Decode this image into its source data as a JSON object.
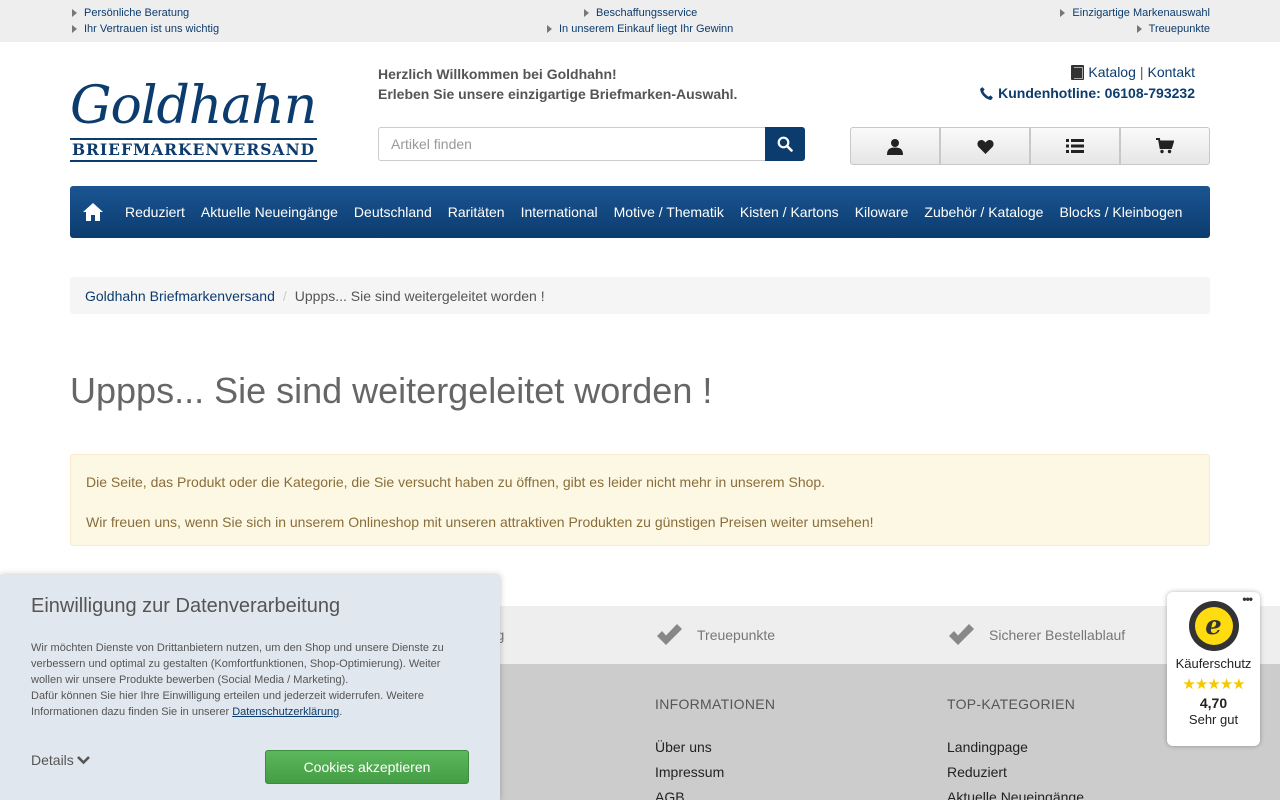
{
  "topbar": {
    "left1": "Persönliche Beratung",
    "left2": "Ihr Vertrauen ist uns wichtig",
    "center1": "Beschaffungsservice",
    "center2": "In unserem Einkauf liegt Ihr Gewinn",
    "right1": "Einzigartige Markenauswahl",
    "right2": "Treuepunkte"
  },
  "logo": {
    "line1": "Goldhahn",
    "line2": "BRIEFMARKENVERSAND"
  },
  "welcome": {
    "line1": "Herzlich Willkommen bei Goldhahn!",
    "line2": "Erleben Sie unsere einzigartige Briefmarken-Auswahl."
  },
  "headlinks": {
    "katalog": "Katalog",
    "separator": "|",
    "kontakt": "Kontakt",
    "hotline": "Kundenhotline: 06108-793232"
  },
  "search": {
    "placeholder": "Artikel finden"
  },
  "nav": {
    "items": [
      "Reduziert",
      "Aktuelle Neueingänge",
      "Deutschland",
      "Raritäten",
      "International",
      "Motive / Thematik",
      "Kisten / Kartons",
      "Kiloware",
      "Zubehör / Kataloge",
      "Blocks / Kleinbogen"
    ]
  },
  "breadcrumb": {
    "home": "Goldhahn Briefmarkenversand",
    "separator": "/",
    "current": "Uppps... Sie sind weitergeleitet worden !"
  },
  "page": {
    "title": "Uppps... Sie sind weitergeleitet worden !"
  },
  "alert": {
    "line1": "Die Seite, das Produkt oder die Kategorie, die Sie versucht haben zu öffnen, gibt es leider nicht mehr in unserem Shop.",
    "line2": "Wir freuen uns, wenn Sie sich in unserem Onlineshop mit unseren attraktiven Produkten zu günstigen Preisen weiter umsehen!"
  },
  "usp": {
    "item1": "hlung",
    "item2": "Treuepunkte",
    "item3": "Sicherer Bestellablauf"
  },
  "footer": {
    "info_heading": "INFORMATIONEN",
    "info_links": [
      "Über uns",
      "Impressum",
      "AGB"
    ],
    "top_heading": "TOP-KATEGORIEN",
    "top_links": [
      "Landingpage",
      "Reduziert",
      "Aktuelle Neueingänge"
    ]
  },
  "cookie": {
    "title": "Einwilligung zur Datenverarbeitung",
    "text1": "Wir möchten Dienste von Drittanbietern nutzen, um den Shop und unsere Dienste zu verbessern und optimal zu gestalten (Komfortfunktionen, Shop-Optimierung). Weiter wollen wir unsere Produkte bewerben (Social Media / Marketing).",
    "text2": "Dafür können Sie hier Ihre Einwilligung erteilen und jederzeit widerrufen. Weitere Informationen dazu finden Sie in unserer",
    "link": "Datenschutzerklärung",
    "dot": ".",
    "details": "Details",
    "accept": "Cookies akzeptieren"
  },
  "trustedshops": {
    "dots": "•••",
    "seal": "e",
    "label": "Käuferschutz",
    "stars": "★★★★★",
    "rating": "4,70",
    "rating_text": "Sehr gut"
  },
  "colors": {
    "brand": "#0c3c6e",
    "accept": "#5cb85c",
    "alert_bg": "#fcf8e3",
    "star": "#f4c900"
  }
}
